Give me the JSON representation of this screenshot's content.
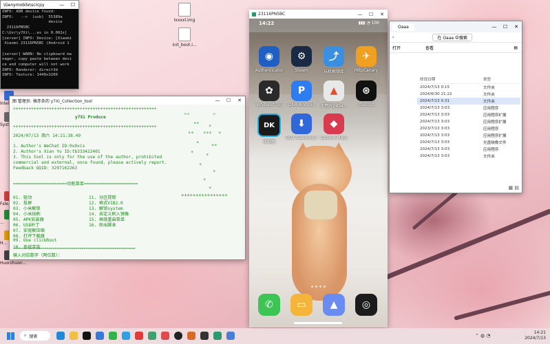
{
  "desktop": {
    "files": [
      {
        "label": "lxxxxl.img"
      },
      {
        "label": "init_boot.i..."
      }
    ],
    "side_icons": [
      {
        "label": "Intel...",
        "color": "#3a6fd8"
      },
      {
        "label": "System...",
        "color": "#6c6c6c"
      },
      {
        "label": "Fsle...",
        "color": "#d24040"
      },
      {
        "label": "...",
        "color": "#2a8a3a"
      },
      {
        "label": "H...",
        "color": "#e0a010"
      },
      {
        "label": "Huorzhuon...",
        "color": "#444"
      }
    ]
  },
  "terminal": {
    "title": "\\Genymobile\\scrcpy",
    "lines": [
      "INFO: ADB device found:",
      "INFO:   -->  (usb)  55389a",
      "                    device",
      "  23116PN5BC",
      "C:\\Usr\\y7Xi\\...es in 0.002s]",
      "[server] INFO: Device: [Xiaomi",
      " Xiaomi 23116PN5BC (Android 1",
      "",
      "[server] WARN: No clipboard ma",
      "nager, copy paste between devi",
      "ce and computer will not work",
      "INFO: Renderer: direct3d",
      "INFO: Texture: 1440x3200"
    ]
  },
  "tool": {
    "title": "图 管理员: 搞赤条的 y7Xi_Collection_tool",
    "border": "++++++++++++++++++++++++++++++++++++++++++++++++++++++++",
    "product": "y7Xi Produce",
    "datetime": "2024/07/13 周六 14:21:38.49",
    "notes": [
      "1. Author's WeChat ID:0x0xis",
      "2. Author's Xian Yu ID:tb333422401",
      "3. This tool is only for the use of the author, prohibited",
      "commercial and external, once found, please actively report.",
      "Feedback QQID: 3297162263"
    ],
    "section": "=====================功能菜单=====================",
    "menu_left": [
      "01. 驱动",
      "02. 投屏",
      "03. 小米解锁",
      "04. 小米线刷",
      "05. APK安装器",
      "06. USB补丁",
      "07. 安驱解压缩",
      "08. 打开下载器",
      "09. One clickRoot",
      "10. 系统字库"
    ],
    "menu_right": [
      "11. 分区提取",
      "12. 格式VIB2.0",
      "13. 解锁system",
      "14. 自定义刷入镜像",
      "15. 高级重启菜单",
      "16. 助出脚本"
    ],
    "divider": "===========================================================",
    "prompt": "输入对应数字（两位数）："
  },
  "phone": {
    "title": "23116PN5BC",
    "time": "14:22",
    "status": "▮▮▮ ◔ 100",
    "apps": [
      {
        "label": "Authenticator",
        "color": "#1f5fc4",
        "glyph": "◉"
      },
      {
        "label": "Steam",
        "color": "#1b2a44",
        "glyph": "⚙"
      },
      {
        "label": "玩机解锁库",
        "color": "#3a8fe0",
        "glyph": "⤴"
      },
      {
        "label": "HttpCanary",
        "color": "#f0a020",
        "glyph": "✈"
      },
      {
        "label": "Whitelist GG",
        "color": "#2a2a2a",
        "glyph": "✿"
      },
      {
        "label": "DNA-Android",
        "color": "#2f7cf0",
        "glyph": "P"
      },
      {
        "label": "大哥片2404...",
        "color": "#e8e8e8",
        "glyph": "▲"
      },
      {
        "label": "chatgpt",
        "color": "#111",
        "glyph": "⊛"
      },
      {
        "label": "压缩器",
        "color": "#1a1a1a",
        "glyph": "DK"
      },
      {
        "label": "DSU Sideloader",
        "color": "#3167d8",
        "glyph": "⬇"
      },
      {
        "label": "Kitsune Mask",
        "color": "#d83a50",
        "glyph": "◆"
      }
    ],
    "dock": [
      {
        "label": "phone",
        "color": "#3cc454",
        "glyph": "✆"
      },
      {
        "label": "notes",
        "color": "#f5b53a",
        "glyph": "▭"
      },
      {
        "label": "gallery",
        "color": "#6a8bf0",
        "glyph": "▲"
      },
      {
        "label": "camera",
        "color": "#1c1c1c",
        "glyph": "◎"
      }
    ]
  },
  "explorer": {
    "tab": "Oaaa",
    "address": "在 Oaaa 中搜索",
    "toolbar": [
      "打开",
      "查看"
    ],
    "columns": [
      "修改日期",
      "类型"
    ],
    "rows": [
      {
        "date": "2024/7/13 0:15",
        "type": "文件夹"
      },
      {
        "date": "2024/6/30 21:22",
        "type": "文件夹"
      },
      {
        "date": "2024/7/13 0:31",
        "type": "文件夹"
      },
      {
        "date": "2024/7/13 3:03",
        "type": "应用程序"
      },
      {
        "date": "2024/7/13 3:03",
        "type": "应用程序扩展"
      },
      {
        "date": "2024/7/13 3:03",
        "type": "应用程序扩展"
      },
      {
        "date": "2023/7/13 3:03",
        "type": "应用程序"
      },
      {
        "date": "2024/7/13 3:03",
        "type": "应用程序扩展"
      },
      {
        "date": "2024/7/13 3:03",
        "type": "光盘映像文件"
      },
      {
        "date": "2024/7/13 3:03",
        "type": "应用程序"
      },
      {
        "date": "2024/7/13 3:03",
        "type": "文件夹"
      }
    ],
    "selected_index": 2
  },
  "taskbar": {
    "search_label": "搜索",
    "icons": [
      {
        "name": "edge-icon",
        "color": "#1e8ad6"
      },
      {
        "name": "explorer-icon",
        "color": "#f2c040"
      },
      {
        "name": "qq-icon",
        "color": "#111"
      },
      {
        "name": "store-icon",
        "color": "#3a78d8"
      },
      {
        "name": "wechat-icon",
        "color": "#2fb548"
      },
      {
        "name": "bilibili-icon",
        "color": "#2ea0e6"
      },
      {
        "name": "music-icon",
        "color": "#e23b3b"
      },
      {
        "name": "app-icon",
        "color": "#3f9f6f"
      },
      {
        "name": "calendar-icon",
        "color": "#e04a4a"
      },
      {
        "name": "record-icon",
        "color": "#222"
      },
      {
        "name": "photo-icon",
        "color": "#d86a2a"
      },
      {
        "name": "terminal-icon",
        "color": "#333"
      },
      {
        "name": "scrcpy-icon",
        "color": "#2a9a6a"
      },
      {
        "name": "files-icon",
        "color": "#4a7fd8"
      }
    ],
    "time": "14:21",
    "date": "2024/7/13"
  }
}
